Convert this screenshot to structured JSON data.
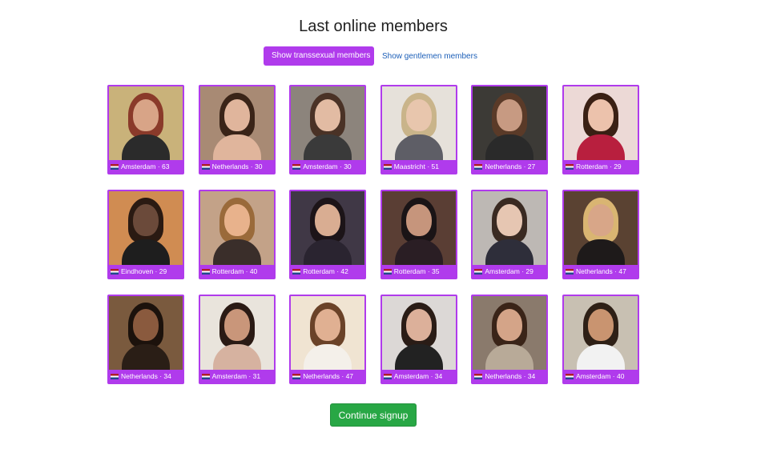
{
  "title": "Last online members",
  "toggle": {
    "active_label": "Show transsexual members",
    "other_label": "Show gentlemen members"
  },
  "colors": {
    "accent": "#b03bec",
    "link": "#1c5fb8",
    "cta": "#28a745"
  },
  "members": [
    {
      "city": "Amsterdam",
      "age": "63",
      "caption": "Amsterdam · 63",
      "bg": "#c9b27a",
      "hair": "#8a3a2a",
      "skin": "#d8a487",
      "cloth": "#2b2b2b"
    },
    {
      "city": "Netherlands",
      "age": "30",
      "caption": "Netherlands · 30",
      "bg": "#a88a74",
      "hair": "#3a2418",
      "skin": "#e0b59c",
      "cloth": "#e0b59c"
    },
    {
      "city": "Amsterdam",
      "age": "30",
      "caption": "Amsterdam · 30",
      "bg": "#8c847c",
      "hair": "#4a3226",
      "skin": "#e2bba3",
      "cloth": "#3a3a3a"
    },
    {
      "city": "Maastricht",
      "age": "51",
      "caption": "Maastricht · 51",
      "bg": "#e6e1da",
      "hair": "#c9b48a",
      "skin": "#e8c6ad",
      "cloth": "#5e5e66"
    },
    {
      "city": "Netherlands",
      "age": "27",
      "caption": "Netherlands · 27",
      "bg": "#3c3a36",
      "hair": "#5a3a28",
      "skin": "#c79a82",
      "cloth": "#2a2a2a"
    },
    {
      "city": "Rotterdam",
      "age": "29",
      "caption": "Rotterdam · 29",
      "bg": "#ecd9d6",
      "hair": "#3a2014",
      "skin": "#ecc2ac",
      "cloth": "#b81f3e"
    },
    {
      "city": "Eindhoven",
      "age": "29",
      "caption": "Eindhoven · 29",
      "bg": "#d08c52",
      "hair": "#2a1a12",
      "skin": "#6b4a3a",
      "cloth": "#1e1e1e"
    },
    {
      "city": "Rotterdam",
      "age": "40",
      "caption": "Rotterdam · 40",
      "bg": "#c3a288",
      "hair": "#9a6a3a",
      "skin": "#e8b28c",
      "cloth": "#3a2e2a"
    },
    {
      "city": "Rotterdam",
      "age": "42",
      "caption": "Rotterdam · 42",
      "bg": "#403846",
      "hair": "#1c1418",
      "skin": "#d9ad92",
      "cloth": "#2a2430"
    },
    {
      "city": "Rotterdam",
      "age": "35",
      "caption": "Rotterdam · 35",
      "bg": "#5a3e34",
      "hair": "#1a1416",
      "skin": "#c6957c",
      "cloth": "#2a1e24"
    },
    {
      "city": "Amsterdam",
      "age": "29",
      "caption": "Amsterdam · 29",
      "bg": "#bdb8b4",
      "hair": "#3a2a22",
      "skin": "#e6c6b2",
      "cloth": "#2e2e3a"
    },
    {
      "city": "Netherlands",
      "age": "47",
      "caption": "Netherlands · 47",
      "bg": "#5a4232",
      "hair": "#d9b572",
      "skin": "#d8a688",
      "cloth": "#1e1a1a"
    },
    {
      "city": "Netherlands",
      "age": "34",
      "caption": "Netherlands · 34",
      "bg": "#7a5a3e",
      "hair": "#1c120c",
      "skin": "#8a5a3e",
      "cloth": "#2a1e16"
    },
    {
      "city": "Amsterdam",
      "age": "31",
      "caption": "Amsterdam · 31",
      "bg": "#e9e4dc",
      "hair": "#2a1a14",
      "skin": "#c9967a",
      "cloth": "#d6b2a0"
    },
    {
      "city": "Netherlands",
      "age": "47",
      "caption": "Netherlands · 47",
      "bg": "#f0e4d2",
      "hair": "#6a4228",
      "skin": "#e0b092",
      "cloth": "#f4f0ea"
    },
    {
      "city": "Amsterdam",
      "age": "34",
      "caption": "Amsterdam · 34",
      "bg": "#dcd8d6",
      "hair": "#2a1c16",
      "skin": "#dcb09a",
      "cloth": "#222222"
    },
    {
      "city": "Netherlands",
      "age": "34",
      "caption": "Netherlands · 34",
      "bg": "#8a7a6c",
      "hair": "#3a2418",
      "skin": "#d4a488",
      "cloth": "#b8aa98"
    },
    {
      "city": "Amsterdam",
      "age": "40",
      "caption": "Amsterdam · 40",
      "bg": "#c8c0b2",
      "hair": "#2e2016",
      "skin": "#c99470",
      "cloth": "#f2f2f2"
    }
  ],
  "cta_label": "Continue signup"
}
